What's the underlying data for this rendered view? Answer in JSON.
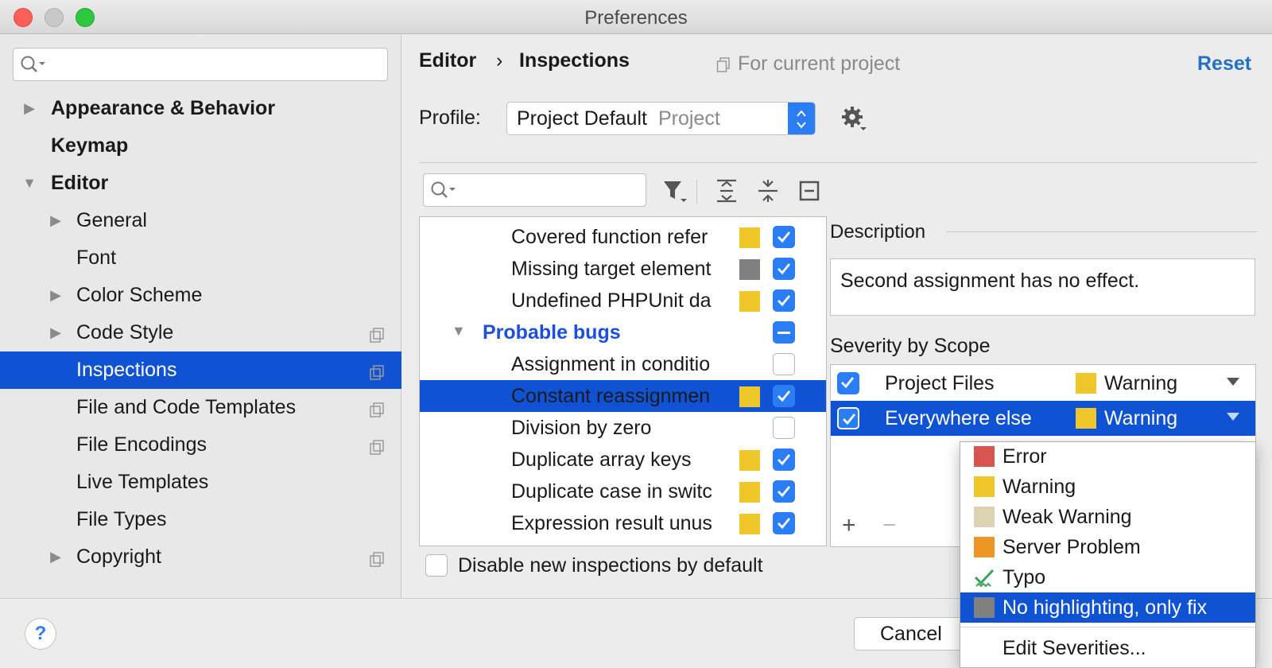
{
  "window": {
    "title": "Preferences"
  },
  "sidebar": {
    "search_placeholder": "",
    "items": [
      {
        "label": "Appearance & Behavior",
        "bold": true,
        "arrow": "collapsed"
      },
      {
        "label": "Keymap",
        "bold": true
      },
      {
        "label": "Editor",
        "bold": true,
        "arrow": "expanded"
      },
      {
        "label": "General",
        "arrow": "collapsed"
      },
      {
        "label": "Font"
      },
      {
        "label": "Color Scheme",
        "arrow": "collapsed"
      },
      {
        "label": "Code Style",
        "arrow": "collapsed",
        "project_icon": true
      },
      {
        "label": "Inspections",
        "selected": true,
        "project_icon": true
      },
      {
        "label": "File and Code Templates",
        "project_icon": true
      },
      {
        "label": "File Encodings",
        "project_icon": true
      },
      {
        "label": "Live Templates"
      },
      {
        "label": "File Types"
      },
      {
        "label": "Copyright",
        "arrow": "collapsed",
        "project_icon": true
      }
    ]
  },
  "breadcrumb": {
    "parent": "Editor",
    "separator": "›",
    "current": "Inspections",
    "scope_note": "For current project"
  },
  "header": {
    "reset_label": "Reset"
  },
  "profile": {
    "label": "Profile:",
    "value": "Project Default",
    "value_sub": "Project"
  },
  "inspections": {
    "search_placeholder": "",
    "rows": [
      {
        "label": "Covered function refer",
        "severity": "#f0c72a",
        "checked": "on"
      },
      {
        "label": "Missing target element",
        "severity": "#808080",
        "checked": "on"
      },
      {
        "label": "Undefined PHPUnit da",
        "severity": "#f0c72a",
        "checked": "on"
      },
      {
        "label": "Probable bugs",
        "group": true,
        "checked": "mixed"
      },
      {
        "label": "Assignment in conditio",
        "severity": null,
        "checked": "off"
      },
      {
        "label": "Constant reassignmen",
        "severity": "#f0c72a",
        "checked": "on",
        "selected": true
      },
      {
        "label": "Division by zero",
        "severity": null,
        "checked": "off"
      },
      {
        "label": "Duplicate array keys",
        "severity": "#f0c72a",
        "checked": "on"
      },
      {
        "label": "Duplicate case in switc",
        "severity": "#f0c72a",
        "checked": "on"
      },
      {
        "label": "Expression result unus",
        "severity": "#f0c72a",
        "checked": "on"
      }
    ],
    "disable_label": "Disable new inspections by default"
  },
  "description": {
    "title": "Description",
    "text": "Second assignment has no effect."
  },
  "severity_scope": {
    "title": "Severity by Scope",
    "rows": [
      {
        "scope": "Project Files",
        "severity": "Warning",
        "color": "#f0c72a"
      },
      {
        "scope": "Everywhere else",
        "severity": "Warning",
        "color": "#f0c72a",
        "selected": true
      }
    ],
    "add_label": "+",
    "remove_label": "−"
  },
  "severity_popup": {
    "items": [
      {
        "label": "Error",
        "color": "#d9534f"
      },
      {
        "label": "Warning",
        "color": "#f0c72a"
      },
      {
        "label": "Weak Warning",
        "color": "#dcd3b2"
      },
      {
        "label": "Server Problem",
        "color": "#ee9625"
      },
      {
        "label": "Typo",
        "icon": "typo-check-icon"
      },
      {
        "label": "No highlighting, only fix",
        "color": "#808080",
        "selected": true
      }
    ],
    "edit_label": "Edit Severities..."
  },
  "footer": {
    "help_label": "?",
    "cancel_label": "Cancel"
  },
  "colors": {
    "accent": "#0f52d4",
    "checkbox": "#2a7df5",
    "link": "#2570c4"
  }
}
